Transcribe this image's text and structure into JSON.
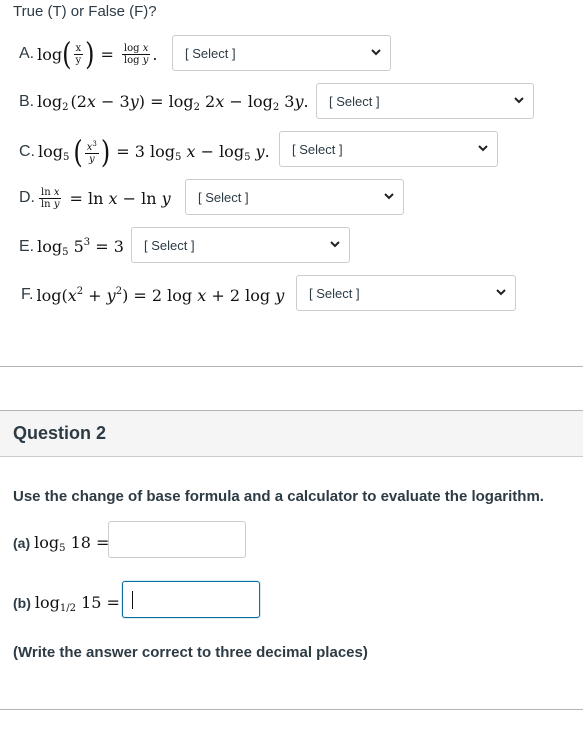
{
  "question1": {
    "intro": "True (T) or False (F)?",
    "items": [
      {
        "letter": "A.",
        "select": "[ Select ]"
      },
      {
        "letter": "B.",
        "select": "[ Select ]"
      },
      {
        "letter": "C.",
        "select": "[ Select ]"
      },
      {
        "letter": "D.",
        "select": "[ Select ]"
      },
      {
        "letter": "E.",
        "select": "[ Select ]"
      },
      {
        "letter": "F.",
        "select": "[ Select ]"
      }
    ],
    "math": {
      "log": "log",
      "ln": "ln",
      "x": "x",
      "y": "y",
      "eq": "=",
      "minus": "−",
      "plus": "+",
      "dot": ".",
      "b_base": "2",
      "c_base": "5",
      "b_lhs_arg": "(2x − 3y)",
      "b_t1": "2x",
      "b_t2": "3y",
      "c_coef": "3",
      "e_base": "5",
      "e_num": "5",
      "e_exp": "3",
      "e_rhs": "3",
      "f_coef": "2",
      "exp2": "2",
      "exp3": "3"
    }
  },
  "question2": {
    "title": "Question 2",
    "instruction": "Use the change of base formula and a calculator to evaluate the logarithm.",
    "part_a": {
      "label": "(a)",
      "base": "5",
      "arg": "18",
      "value": ""
    },
    "part_b": {
      "label": "(b)",
      "base": "1/2",
      "arg": "15",
      "value": ""
    },
    "note": "(Write the answer correct to three decimal places)"
  }
}
